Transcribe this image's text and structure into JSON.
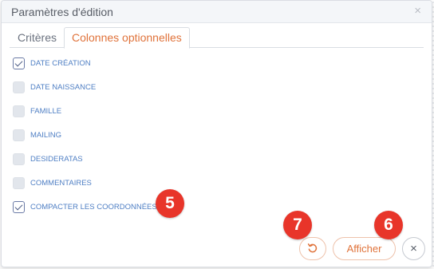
{
  "dialog": {
    "title": "Paramètres d'édition",
    "close_glyph": "×"
  },
  "tabs": [
    {
      "label": "Critères",
      "active": false
    },
    {
      "label": "Colonnes optionnelles",
      "active": true
    }
  ],
  "options": [
    {
      "label": "DATE CRÉATION",
      "checked": true
    },
    {
      "label": "DATE NAISSANCE",
      "checked": false
    },
    {
      "label": "FAMILLE",
      "checked": false
    },
    {
      "label": "MAILING",
      "checked": false
    },
    {
      "label": "DESIDERATAS",
      "checked": false
    },
    {
      "label": "COMMENTAIRES",
      "checked": false
    },
    {
      "label": "COMPACTER LES COORDONNÉES",
      "checked": true
    }
  ],
  "markers": [
    "5",
    "7",
    "6"
  ],
  "footer": {
    "reset_icon": "reset-icon",
    "afficher_label": "Afficher",
    "close_glyph": "×"
  },
  "colors": {
    "accent": "#e0733b",
    "marker": "#e8352a",
    "option_text": "#4f7fc4"
  }
}
